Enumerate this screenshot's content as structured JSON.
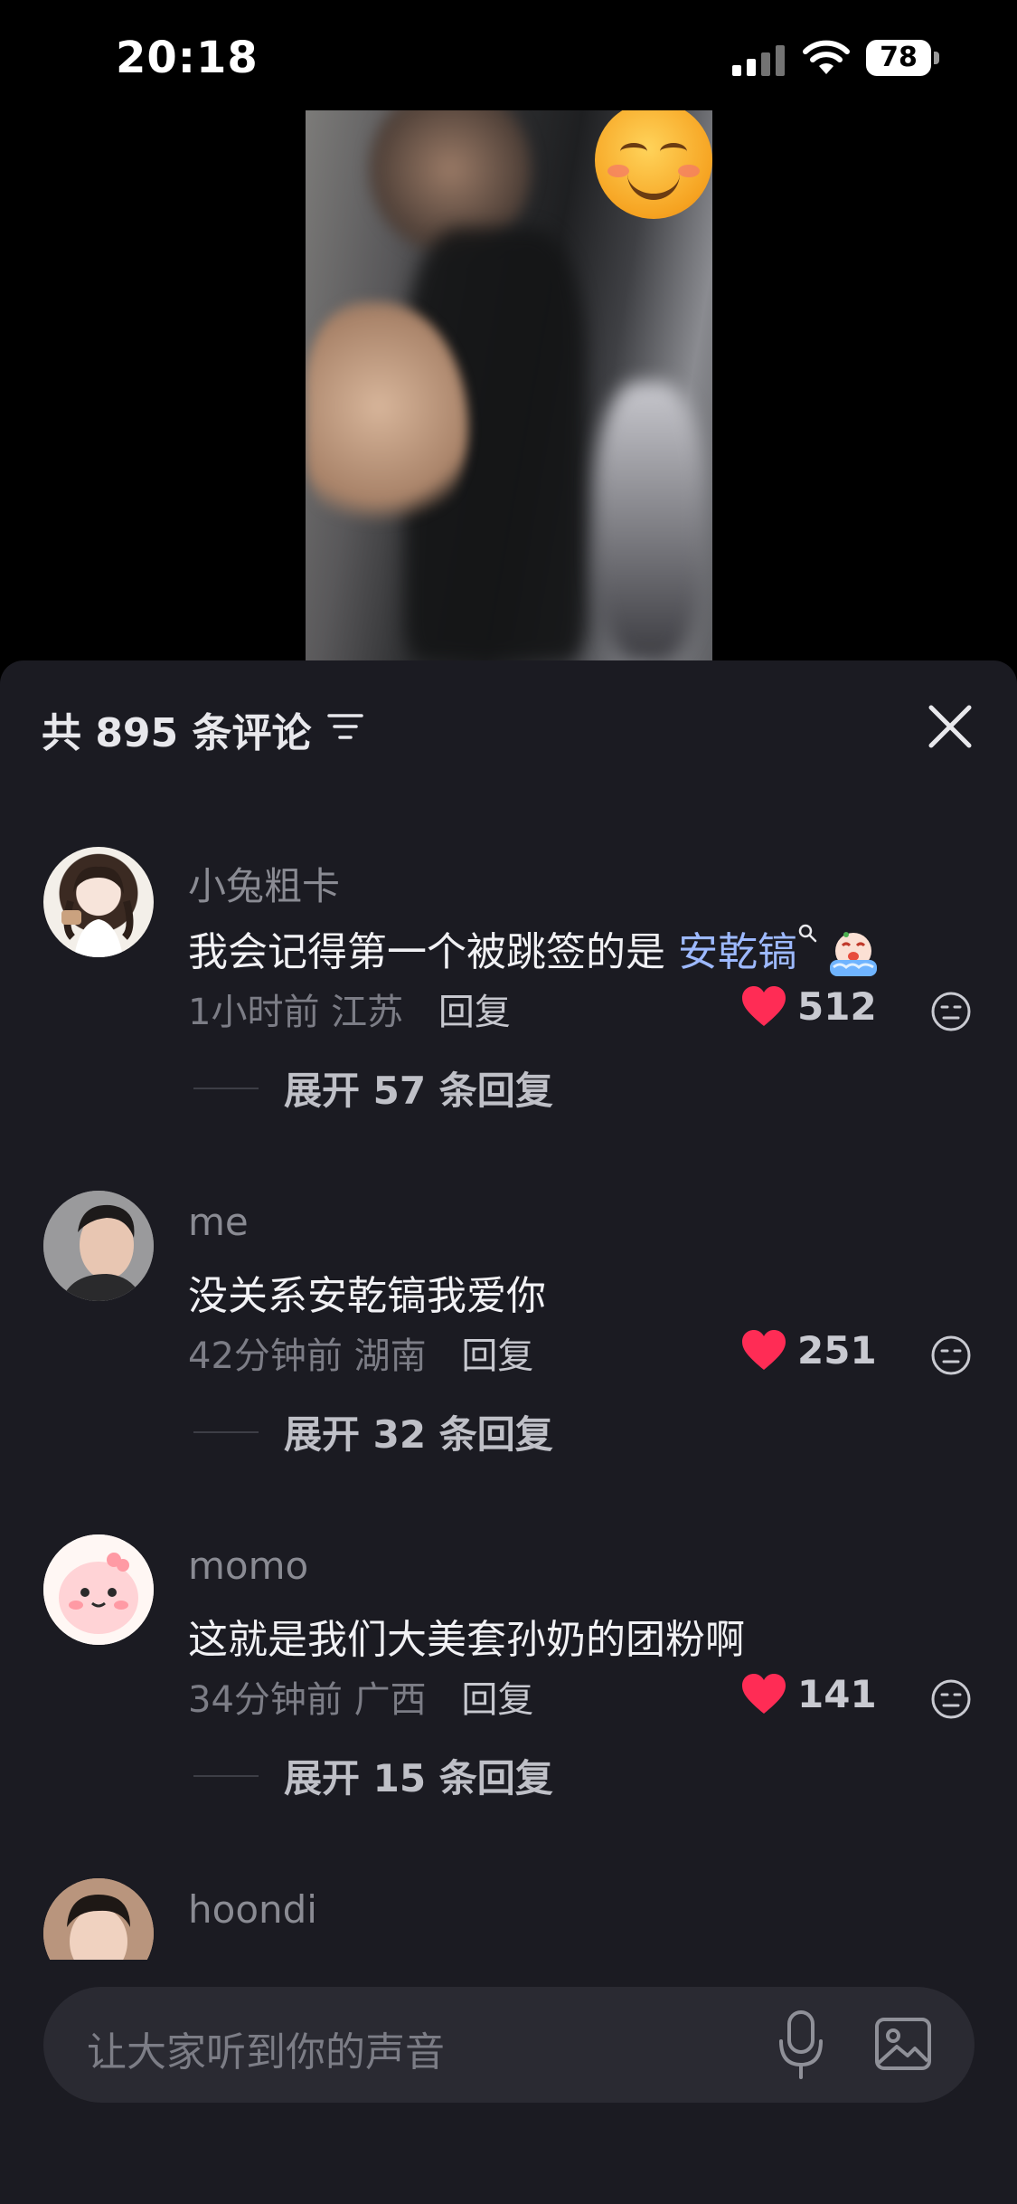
{
  "status_bar": {
    "time": "20:18",
    "battery": "78"
  },
  "comments_header": {
    "title": "共 895 条评论"
  },
  "comments": [
    {
      "username": "小兔粗卡",
      "text": "我会记得第一个被跳签的是",
      "mention": "安乾镐",
      "time": "1小时前",
      "location": "江苏",
      "reply_label": "回复",
      "likes": "512",
      "expand_label": "展开 57 条回复"
    },
    {
      "username": "me",
      "text": "没关系安乾镐我爱你",
      "time": "42分钟前",
      "location": "湖南",
      "reply_label": "回复",
      "likes": "251",
      "expand_label": "展开 32 条回复"
    },
    {
      "username": "momo",
      "text": "这就是我们大美套孙奶的团粉啊",
      "time": "34分钟前",
      "location": "广西",
      "reply_label": "回复",
      "likes": "141",
      "expand_label": "展开 15 条回复"
    },
    {
      "username": "hoondi"
    }
  ],
  "input": {
    "placeholder": "让大家听到你的声音"
  },
  "colors": {
    "sheet_bg": "#1b1b22",
    "like_red": "#ff2c55",
    "mention": "#9db9ff"
  }
}
